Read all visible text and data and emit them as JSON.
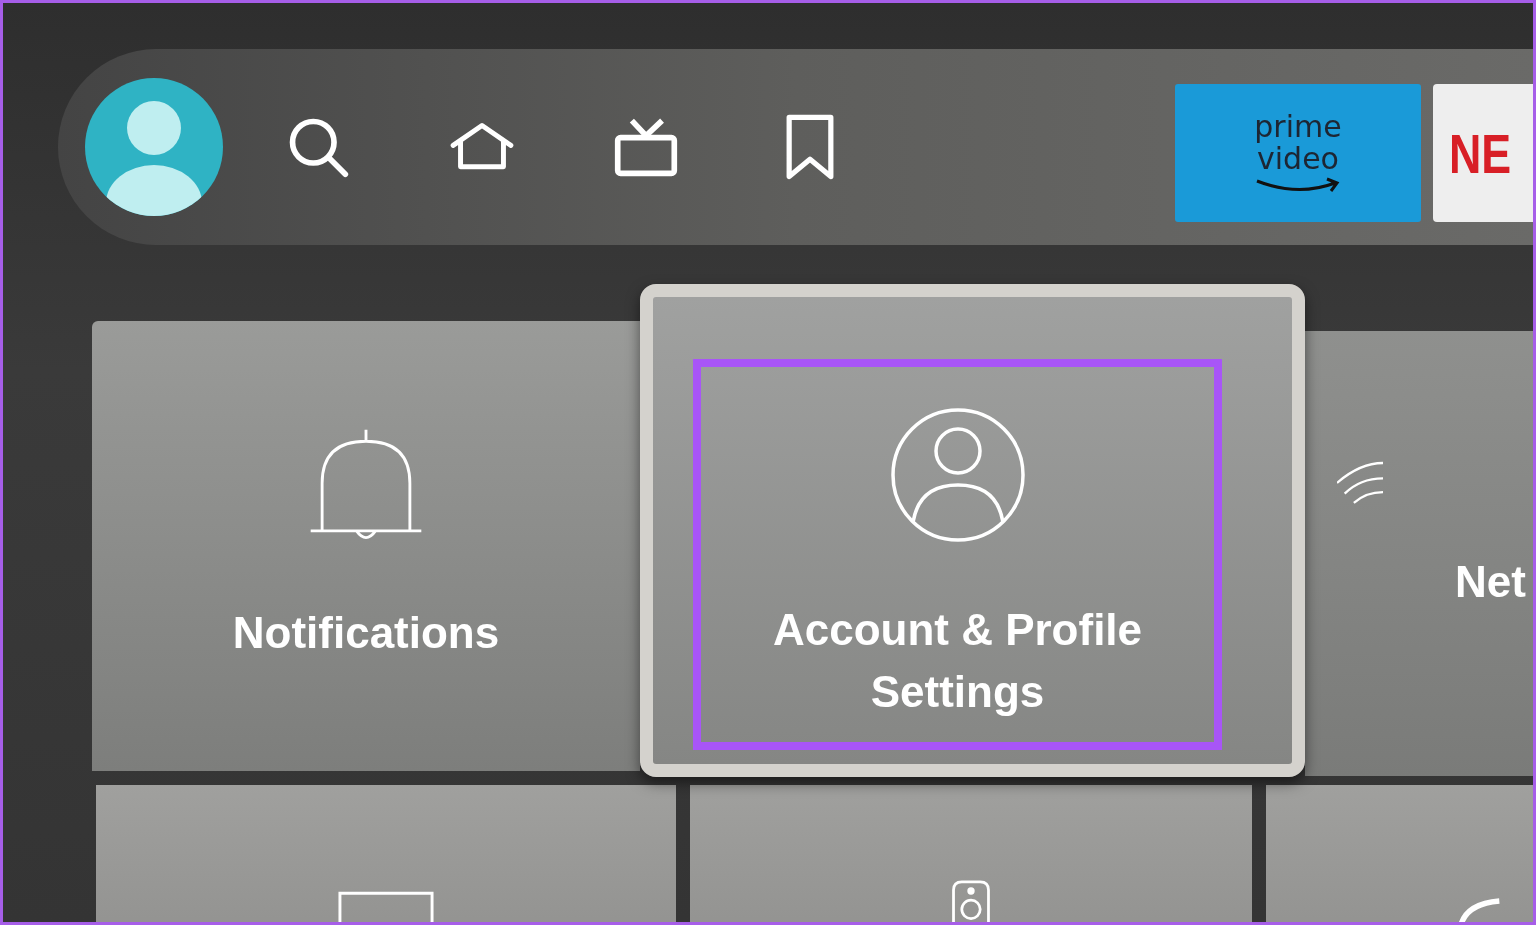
{
  "nav": [
    {
      "kind": "avatar"
    },
    {
      "kind": "search"
    },
    {
      "kind": "home"
    },
    {
      "kind": "tv"
    },
    {
      "kind": "bookmark"
    }
  ],
  "apps": [
    {
      "kind": "prime",
      "label_top": "prime",
      "label_bottom": "video"
    },
    {
      "kind": "netflix",
      "label": "NE"
    }
  ],
  "tiles": [
    {
      "kind": "bell",
      "label": "Notifications",
      "focused": false
    },
    {
      "kind": "account",
      "label": "Account & Profile Settings",
      "focused": true
    },
    {
      "kind": "wifi",
      "label": "Net",
      "focused": false
    }
  ],
  "bottom_tiles": [
    {
      "kind": "display"
    },
    {
      "kind": "remote"
    },
    {
      "kind": "round"
    }
  ]
}
